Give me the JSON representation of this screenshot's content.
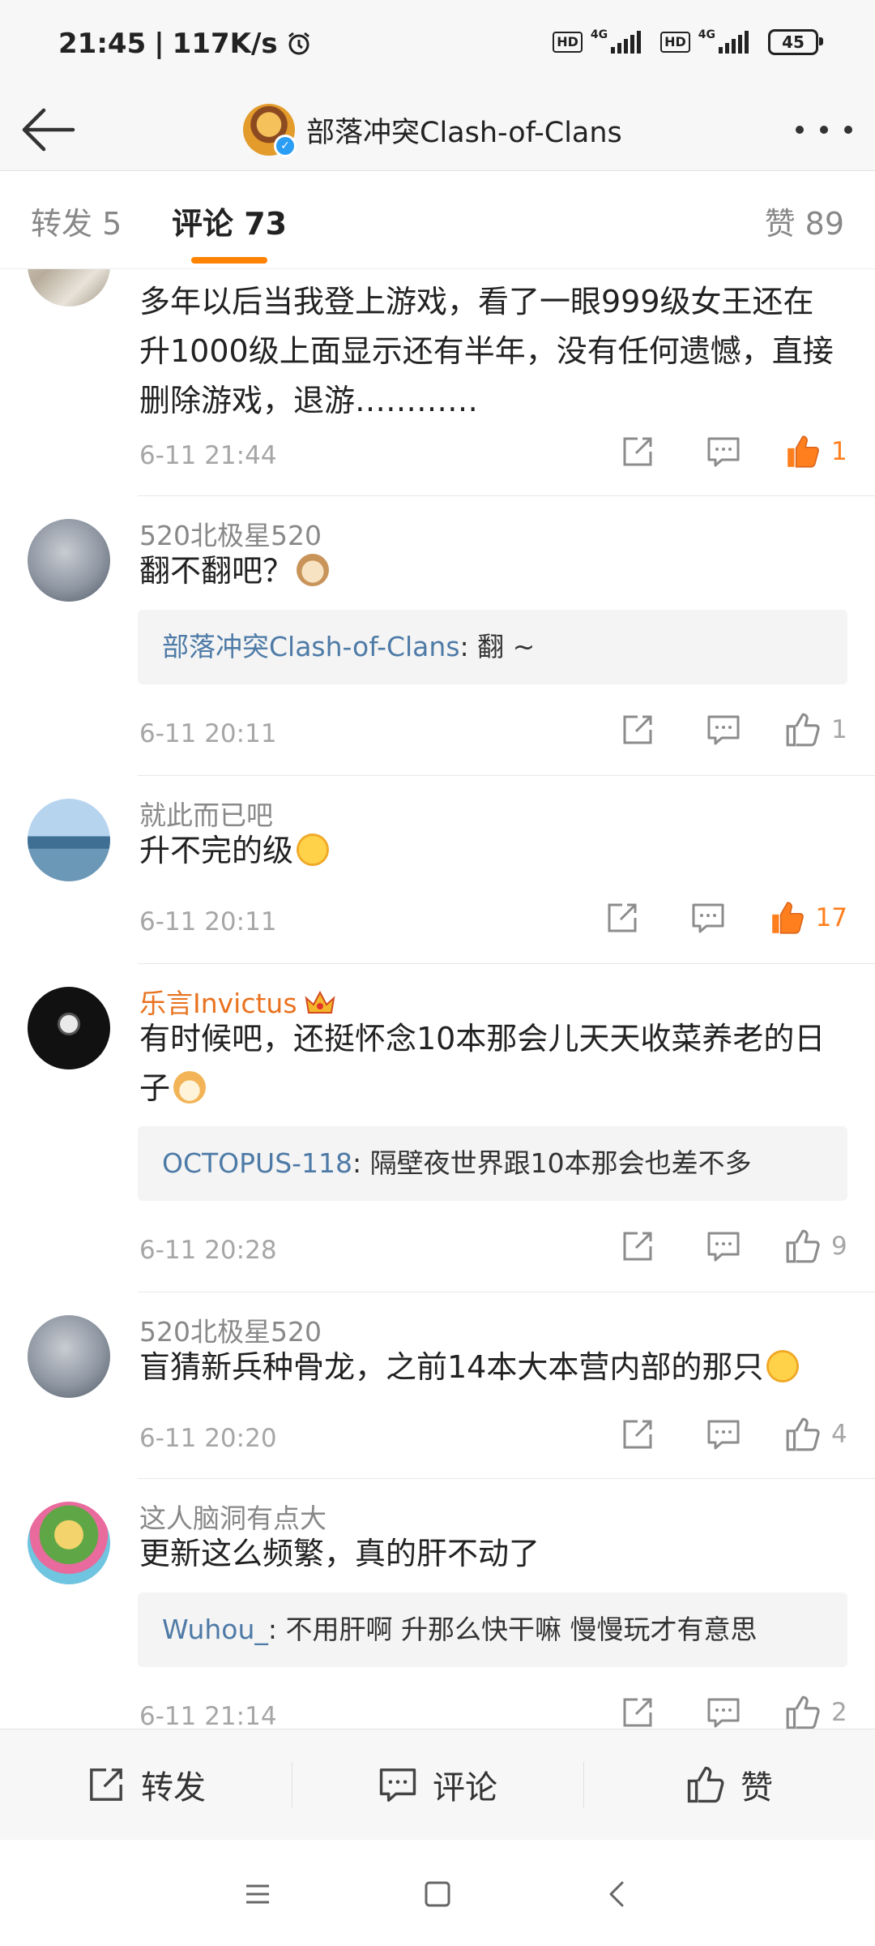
{
  "status_bar": {
    "time": "21:45",
    "speed": "117K/s",
    "sim1_hd": "HD",
    "sim1_net": "4G",
    "sim2_hd": "HD",
    "sim2_net": "4G",
    "battery": "45",
    "icons": [
      "alarm-icon",
      "signal-icon",
      "battery-icon"
    ]
  },
  "nav": {
    "title": "部落冲突Clash-of-Clans",
    "icons": [
      "back-arrow-icon",
      "verified-badge-icon",
      "more-dots-icon"
    ]
  },
  "tabs": {
    "repost": "转发 5",
    "comments": "评论 73",
    "likes": "赞 89",
    "active": "comments",
    "accent_color": "#ff8200"
  },
  "comments": [
    {
      "user": "",
      "text": "多年以后当我登上游戏，看了一眼999级女王还在升1000级上面显示还有半年，没有任何遗憾，直接删除游戏，退游…………",
      "time": "6-11 21:44",
      "likes": "1",
      "liked": true
    },
    {
      "user": "520北极星520",
      "text": "翻不翻吧？",
      "emoji": "cat-emoji",
      "reply_user": "部落冲突Clash-of-Clans",
      "reply_text": ": 翻 ~",
      "time": "6-11 20:11",
      "likes": "1",
      "liked": false
    },
    {
      "user": "就此而已吧",
      "text": "升不完的级",
      "emoji": "laugh-cry-emoji",
      "time": "6-11 20:11",
      "likes": "17",
      "liked": true
    },
    {
      "user": "乐言Invictus",
      "vip_badge": "crown-icon",
      "text": "有时候吧，还挺怀念10本那会儿天天收菜养老的日子",
      "emoji": "doge-emoji",
      "reply_user": "OCTOPUS-118",
      "reply_text": ": 隔壁夜世界跟10本那会也差不多",
      "time": "6-11 20:28",
      "likes": "9",
      "liked": false
    },
    {
      "user": "520北极星520",
      "text": "盲猜新兵种骨龙，之前14本大本营内部的那只",
      "emoji": "surprised-emoji",
      "time": "6-11 20:20",
      "likes": "4",
      "liked": false
    },
    {
      "user": "这人脑洞有点大",
      "text": "更新这么频繁，真的肝不动了",
      "reply_user": "Wuhou_",
      "reply_text": ": 不用肝啊 升那么快干嘛 慢慢玩才有意思",
      "time": "6-11 21:14",
      "likes": "2",
      "liked": false
    }
  ],
  "bottom_bar": {
    "repost": "转发",
    "comment": "评论",
    "like": "赞"
  },
  "system_nav": [
    "menu-icon",
    "home-icon",
    "back-icon"
  ]
}
